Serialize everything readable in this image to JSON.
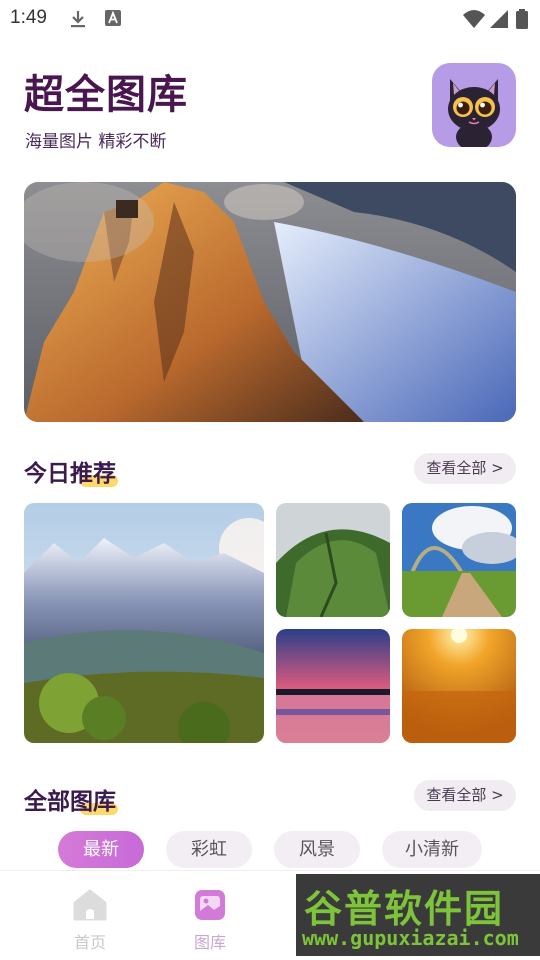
{
  "status_bar": {
    "time": "1:49"
  },
  "header": {
    "title": "超全图库",
    "subtitle": "海量图片 精彩不断"
  },
  "today": {
    "title": "今日推荐",
    "view_all": "查看全部 >"
  },
  "gallery": {
    "title": "全部图库",
    "view_all": "查看全部 >",
    "tabs": [
      {
        "label": "最新",
        "active": true
      },
      {
        "label": "彩虹",
        "active": false
      },
      {
        "label": "风景",
        "active": false
      },
      {
        "label": "小清新",
        "active": false
      }
    ]
  },
  "bottom_nav": {
    "items": [
      {
        "label": "首页",
        "icon": "home-icon",
        "active": false
      },
      {
        "label": "图库",
        "icon": "gallery-icon",
        "active": true
      }
    ]
  },
  "watermark": {
    "brand": "谷普软件园",
    "url": "www.gupuxiazai.com"
  },
  "colors": {
    "title": "#4a1650",
    "accent": "#c76ad9",
    "highlight": "#ffd86b",
    "avatar_bg": "#b69be6"
  }
}
